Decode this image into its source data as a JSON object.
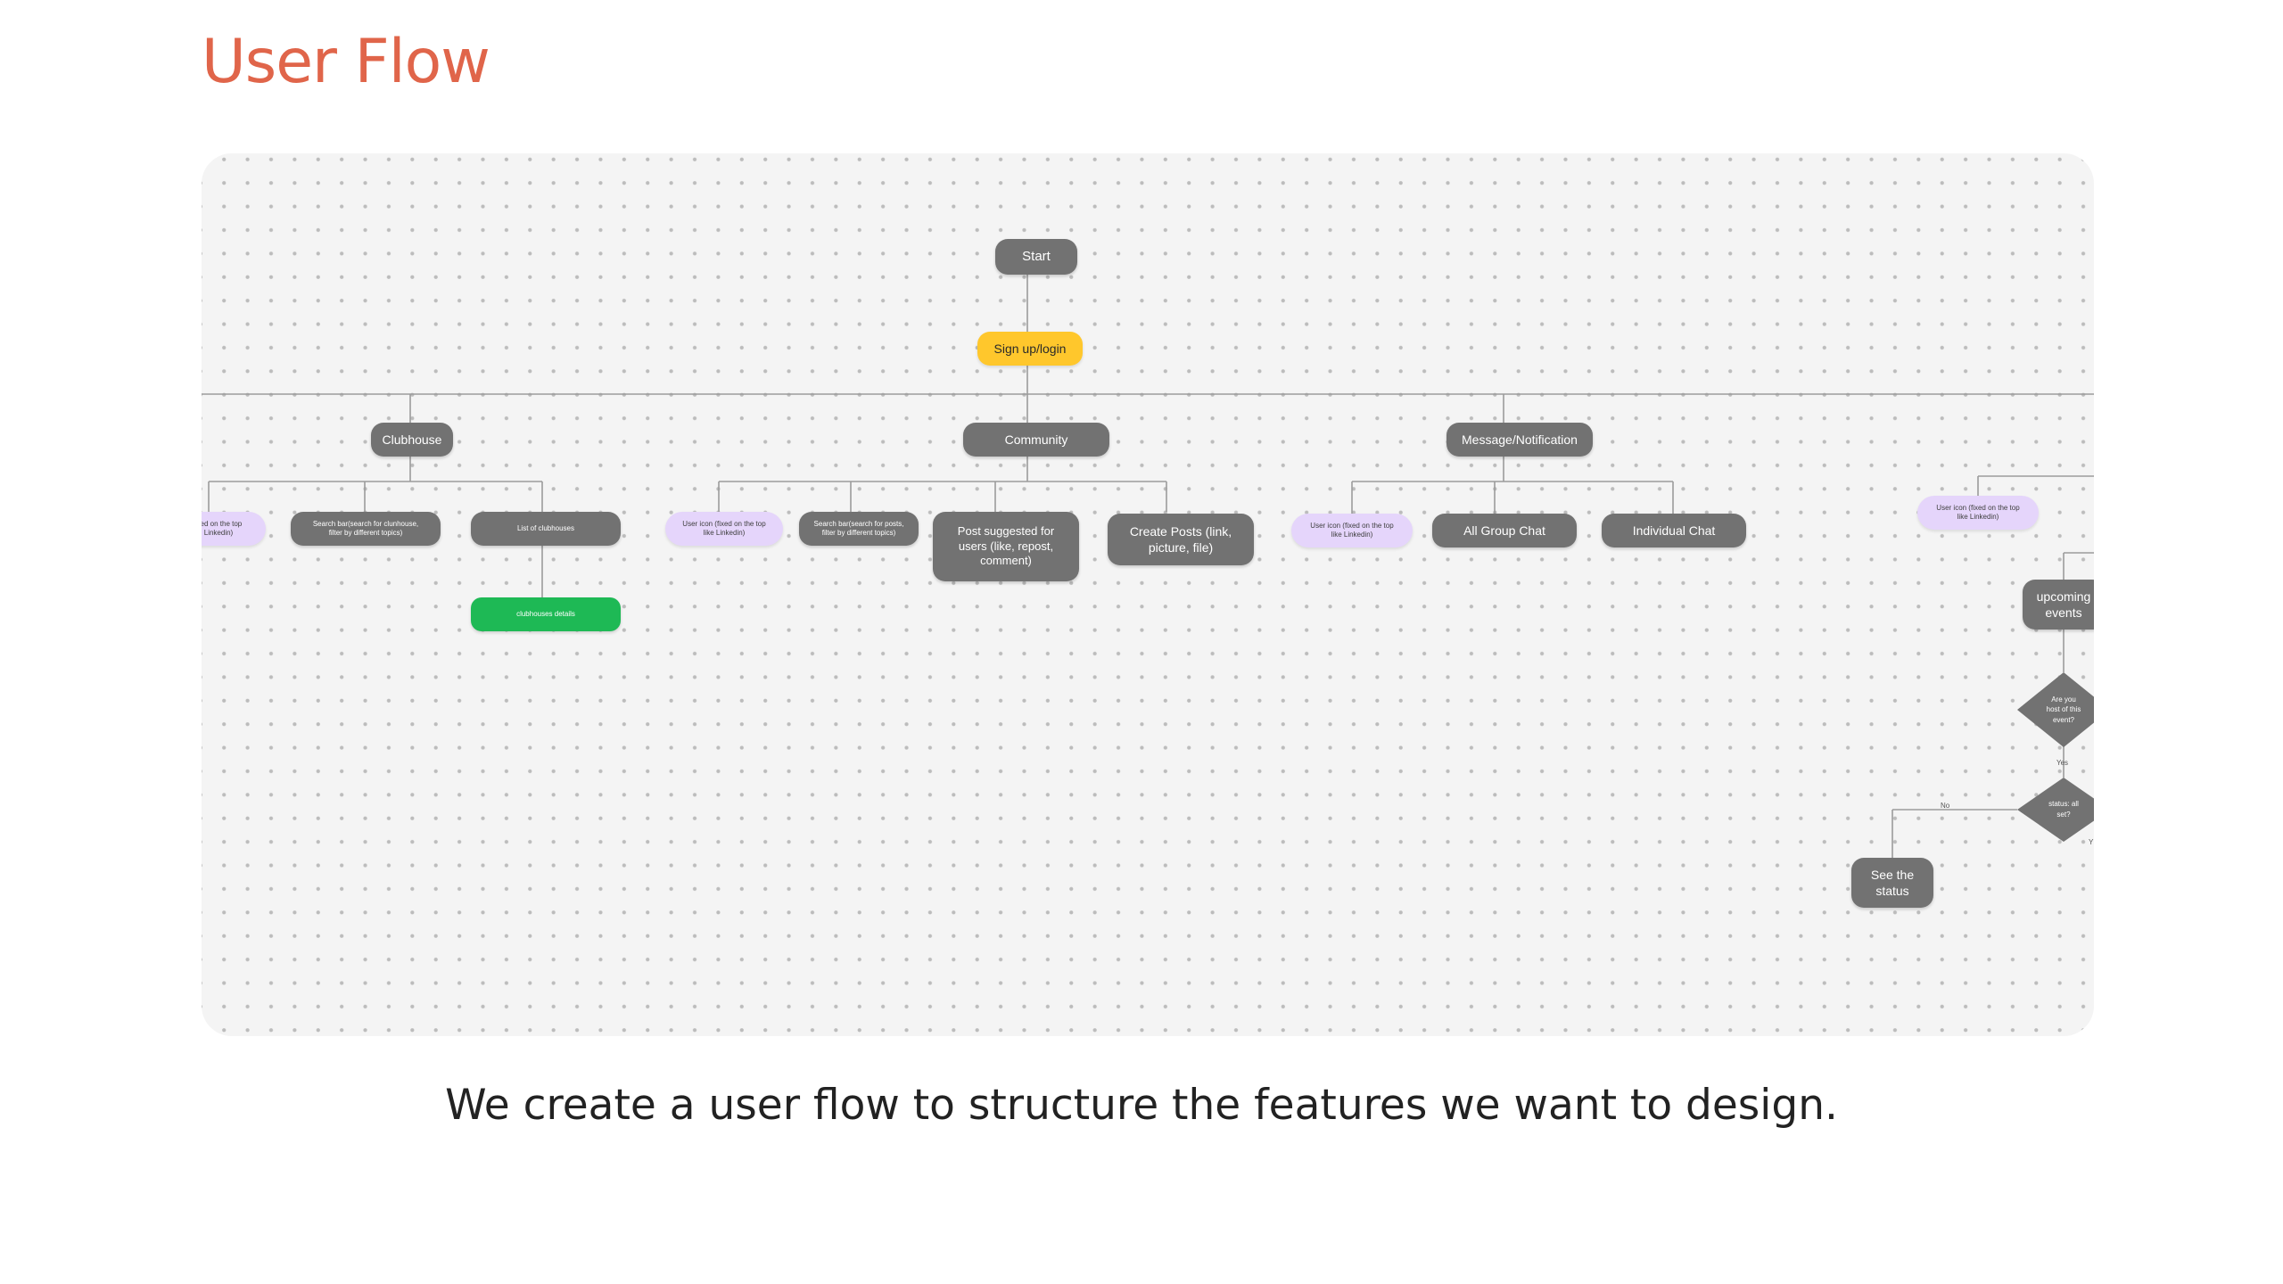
{
  "page": {
    "title": "User Flow",
    "caption": "We create a user flow to structure the features we want to design."
  },
  "colors": {
    "title": "#e0654a",
    "caption": "#222222",
    "canvas_bg": "#f4f4f4",
    "canvas_dot": "#bcbcbc",
    "node_gray": "#727272",
    "node_yellow": "#ffc72c",
    "node_green": "#1eb955",
    "node_purple": "#e5d5fb",
    "connector": "#9b9b9b"
  },
  "diagram": {
    "start": "Start",
    "login": "Sign up/login",
    "clubhouse": {
      "title": "Clubhouse",
      "user_icon": "ixed on the top\nLinkedin)",
      "search": "Search bar(search for clunhouse,\nfilter by different topics)",
      "list": "List of clubhouses",
      "details": "clubhouses details"
    },
    "community": {
      "title": "Community",
      "user_icon": "User icon (fixed on the top\nlike Linkedin)",
      "search": "Search bar(search for posts,\nfilter by different topics)",
      "post_suggested": "Post suggested for\nusers (like, repost,\ncomment)",
      "create_posts": "Create Posts (link,\npicture, file)"
    },
    "message": {
      "title": "Message/Notification",
      "user_icon": "User icon (fixed on the top\nlike Linkedin)",
      "group_chat": "All Group Chat",
      "individual_chat": "Individual Chat"
    },
    "events": {
      "user_icon": "User icon (fixed on the top\nlike Linkedin)",
      "upcoming": "upcoming\nevents",
      "host_question": "Are you\nhost of this\nevent?",
      "yes": "Yes",
      "status_question": "status: all\nset?",
      "no": "No",
      "see_status": "See the\nstatus",
      "cut_label": "Y"
    }
  }
}
